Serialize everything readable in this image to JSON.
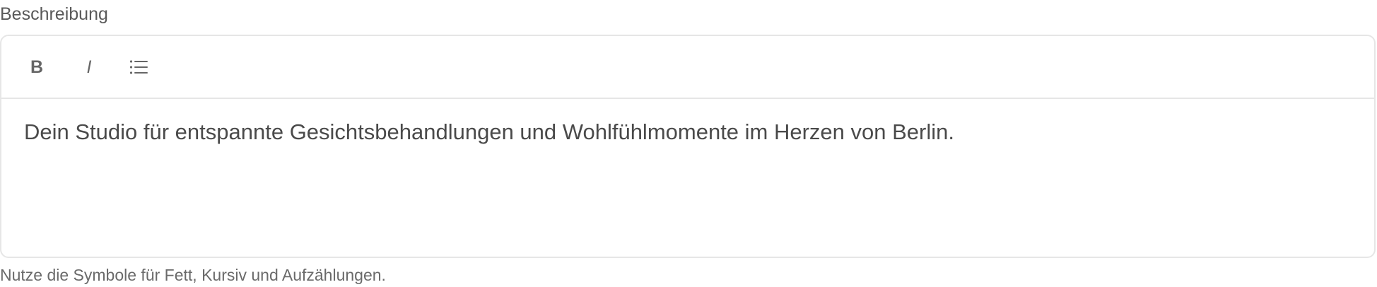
{
  "field": {
    "label": "Beschreibung",
    "hint": "Nutze die Symbole für Fett, Kursiv und Aufzählungen."
  },
  "toolbar": {
    "bold_label": "B",
    "italic_label": "I",
    "list_icon": "bulleted-list-icon"
  },
  "editor": {
    "value": "Dein Studio für entspannte Gesichtsbehandlungen und Wohlfühlmomente im Herzen von Berlin."
  }
}
